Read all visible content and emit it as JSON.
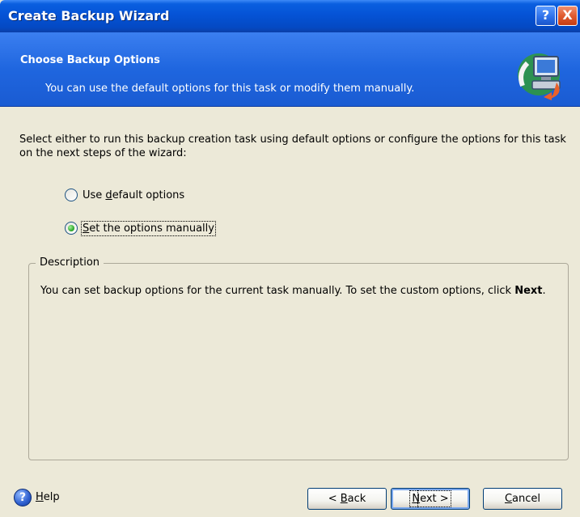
{
  "window": {
    "title": "Create Backup Wizard"
  },
  "titlebar_buttons": {
    "help": "?",
    "close": "X"
  },
  "header": {
    "title": "Choose Backup Options",
    "subtitle": "You can use the default options for this task or modify them manually.",
    "icon": "backup-computer-icon"
  },
  "intro": "Select either to run this backup creation task using default options or configure the options for this task on the next steps of the wizard:",
  "options": [
    {
      "pre": "Use ",
      "mnemonic": "d",
      "post": "efault options",
      "checked": false
    },
    {
      "pre": "",
      "mnemonic": "S",
      "post": "et the options manually",
      "checked": true
    }
  ],
  "description": {
    "legend": "Description",
    "text": "You can set backup options for the current task manually. To set the custom options, click",
    "bold": "Next",
    "tail": "."
  },
  "footer": {
    "help_icon": "?",
    "help_pre": "",
    "help_mn": "H",
    "help_post": "elp",
    "back": {
      "pre": "< ",
      "mn": "B",
      "post": "ack"
    },
    "next": {
      "pre": "",
      "mn": "N",
      "post": "ext >"
    },
    "cancel": {
      "pre": "",
      "mn": "C",
      "post": "ancel"
    }
  },
  "colors": {
    "titlebar": "#0553d6",
    "header": "#1f66df",
    "dialog_bg": "#ece9d8",
    "close_button": "#e05c30"
  }
}
